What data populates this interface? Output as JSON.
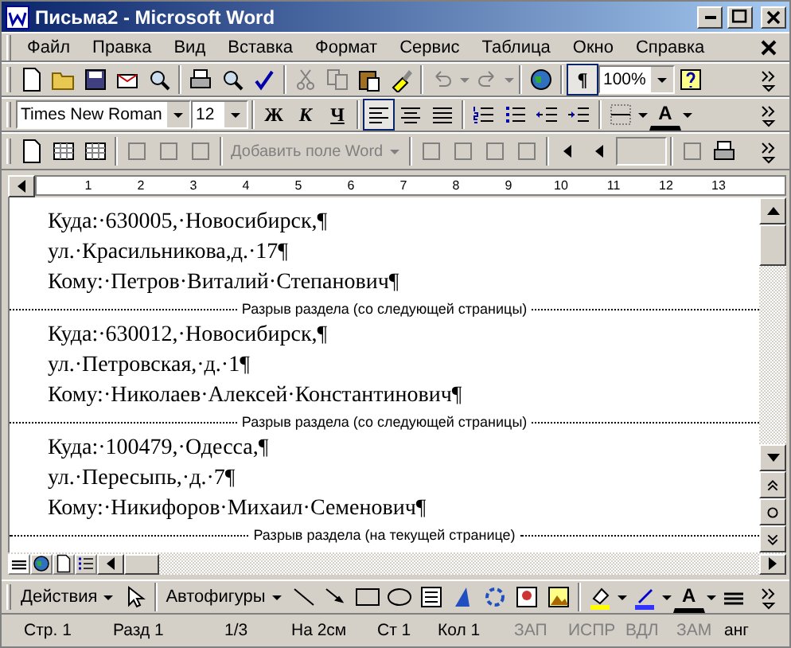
{
  "window": {
    "title": "Письма2 - Microsoft Word"
  },
  "menu": [
    "Файл",
    "Правка",
    "Вид",
    "Вставка",
    "Формат",
    "Сервис",
    "Таблица",
    "Окно",
    "Справка"
  ],
  "standard_toolbar": {
    "show_marks": {
      "label": "¶",
      "selected": true
    },
    "zoom": "100%"
  },
  "formatting_toolbar": {
    "font": "Times New Roman",
    "size": "12",
    "bold": "Ж",
    "italic": "К",
    "underline": "Ч",
    "alignment": [
      {
        "selected": true
      },
      {
        "selected": false
      },
      {
        "selected": false
      }
    ],
    "font_color": "A"
  },
  "mail_merge_toolbar": {
    "insert_field": "Добавить поле Word",
    "disabled": true
  },
  "ruler": [
    "1",
    "2",
    "3",
    "4",
    "5",
    "6",
    "7",
    "8",
    "9",
    "10",
    "11",
    "12",
    "13"
  ],
  "document": [
    {
      "kind": "paragraph",
      "text": "Куда:·630005,·Новосибирск,¶"
    },
    {
      "kind": "paragraph",
      "text": "ул.·Красильникова,д.·17¶"
    },
    {
      "kind": "paragraph",
      "text": "Кому:·Петров·Виталий·Степанович¶"
    },
    {
      "kind": "section_break",
      "text": "Разрыв раздела (со следующей страницы)"
    },
    {
      "kind": "paragraph",
      "text": "Куда:·630012,·Новосибирск,¶"
    },
    {
      "kind": "paragraph",
      "text": "ул.·Петровская,·д.·1¶"
    },
    {
      "kind": "paragraph",
      "text": "Кому:·Николаев·Алексей·Константинович¶"
    },
    {
      "kind": "section_break",
      "text": "Разрыв раздела (со следующей страницы)"
    },
    {
      "kind": "paragraph",
      "text": "Куда:·100479,·Одесса,¶"
    },
    {
      "kind": "paragraph",
      "text": "ул.·Пересыпь,·д.·7¶"
    },
    {
      "kind": "paragraph",
      "text": "Кому:·Никифоров·Михаил·Семенович¶"
    },
    {
      "kind": "section_break",
      "text": "Разрыв раздела (на текущей странице)"
    }
  ],
  "drawing_toolbar": {
    "actions": "Действия",
    "autoshapes": "Автофигуры",
    "font_color": "A"
  },
  "status_bar": [
    {
      "text": "Стр. 1",
      "on": true
    },
    {
      "text": "Разд 1",
      "on": true
    },
    {
      "text": "1/3",
      "on": true
    },
    {
      "text": "На 2см",
      "on": true
    },
    {
      "text": "Ст 1",
      "on": true
    },
    {
      "text": "Кол 1",
      "on": true
    },
    {
      "text": "ЗАП",
      "on": false
    },
    {
      "text": "ИСПР",
      "on": false
    },
    {
      "text": "ВДЛ",
      "on": false
    },
    {
      "text": "ЗАМ",
      "on": false
    },
    {
      "text": "анг",
      "on": true
    }
  ]
}
